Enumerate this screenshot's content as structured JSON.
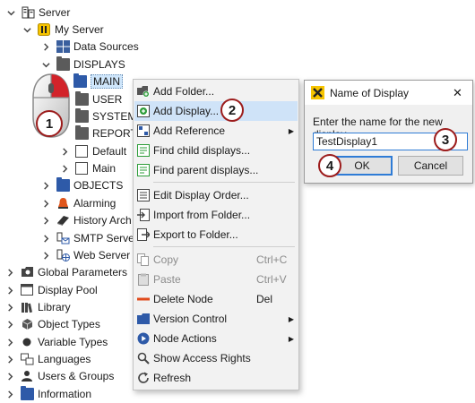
{
  "tree": {
    "server": "Server",
    "my_server": "My Server",
    "data_sources": "Data Sources",
    "displays": "DISPLAYS",
    "main": "MAIN",
    "user": "USER",
    "system": "SYSTEM",
    "report": "REPORT",
    "default": "Default",
    "main_child": "Main",
    "objects": "OBJECTS",
    "alarming": "Alarming",
    "history_archive": "History Arch",
    "smtp_server": "SMTP Server",
    "web_server": "Web Server",
    "global_parameters": "Global Parameters",
    "display_pool": "Display Pool",
    "library": "Library",
    "object_types": "Object Types",
    "variable_types": "Variable Types",
    "languages": "Languages",
    "users_groups": "Users & Groups",
    "information": "Information"
  },
  "context_menu": {
    "add_folder": "Add Folder...",
    "add_display": "Add Display...",
    "add_reference": "Add Reference",
    "find_child": "Find child displays...",
    "find_parent": "Find parent displays...",
    "edit_order": "Edit Display Order...",
    "import_folder": "Import from Folder...",
    "export_folder": "Export to Folder...",
    "copy": "Copy",
    "copy_shortcut": "Ctrl+C",
    "paste": "Paste",
    "paste_shortcut": "Ctrl+V",
    "delete_node": "Delete Node",
    "delete_shortcut": "Del",
    "version_control": "Version Control",
    "node_actions": "Node Actions",
    "show_access_rights": "Show Access Rights",
    "refresh": "Refresh"
  },
  "dialog": {
    "title": "Name of Display",
    "close": "✕",
    "prompt": "Enter the name for the new display",
    "value": "TestDisplay1",
    "ok": "OK",
    "cancel": "Cancel"
  },
  "steps": {
    "s1": "1",
    "s2": "2",
    "s3": "3",
    "s4": "4"
  },
  "colors": {
    "highlight": "#cfe3f8",
    "badge_ring": "#9c1c1c",
    "folder_blue": "#2e5aa8",
    "server_yellow": "#f6c400"
  }
}
